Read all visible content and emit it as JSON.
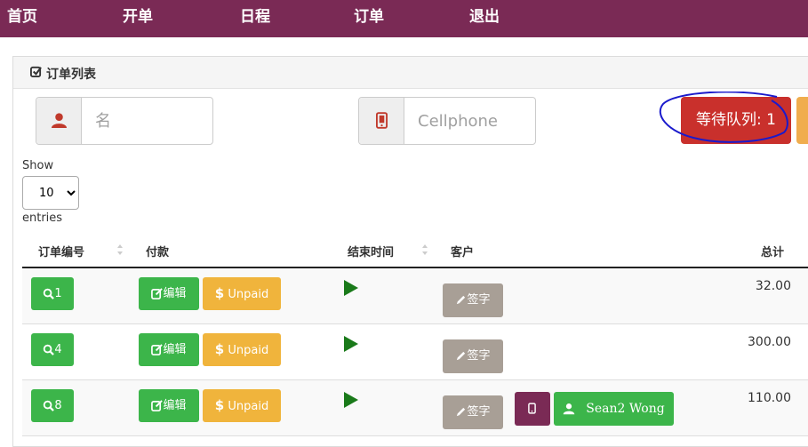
{
  "nav": {
    "items": [
      "首页",
      "开单",
      "日程",
      "订单",
      "退出"
    ]
  },
  "panel": {
    "title": "订单列表"
  },
  "filters": {
    "name_placeholder": "名",
    "phone_placeholder": "Cellphone"
  },
  "queue": {
    "label": "等待队列: 1"
  },
  "length": {
    "show": "Show",
    "value": "10",
    "entries": "entries"
  },
  "table": {
    "headers": {
      "order_no": "订单编号",
      "payment": "付款",
      "end_time": "结束时间",
      "customer": "客户",
      "total": "总计"
    },
    "rows": [
      {
        "id": "1",
        "edit": "编辑",
        "status": "Unpaid",
        "sign": "签字",
        "total": "32.00"
      },
      {
        "id": "4",
        "edit": "编辑",
        "status": "Unpaid",
        "sign": "签字",
        "total": "300.00"
      },
      {
        "id": "8",
        "edit": "编辑",
        "status": "Unpaid",
        "sign": "签字",
        "total": "110.00",
        "customer_name": "Sean2 Wong"
      }
    ]
  },
  "colors": {
    "nav_bg": "#7a2a55",
    "green": "#3cb54a",
    "warning": "#f0b43c",
    "danger": "#c9302c",
    "gray": "#a89f96"
  },
  "icons": {
    "id_button": "search-icon",
    "edit_button": "edit-icon",
    "unpaid_button": "dollar-icon",
    "end_time": "play-icon",
    "sign_button": "pencil-icon",
    "phone_button": "mobile-icon",
    "customer_button": "user-icon"
  }
}
